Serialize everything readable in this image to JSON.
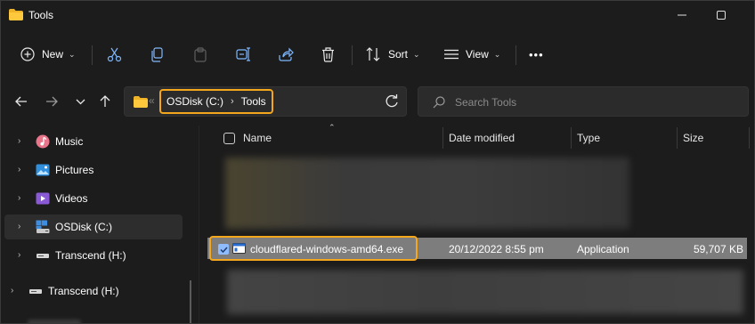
{
  "window": {
    "title": "Tools"
  },
  "toolbar": {
    "new_label": "New",
    "sort_label": "Sort",
    "view_label": "View",
    "more_label": "•••"
  },
  "address": {
    "overflow": "«",
    "crumbs": [
      "OSDisk (C:)",
      "Tools"
    ],
    "separator": "›"
  },
  "search": {
    "placeholder": "Search Tools"
  },
  "sidebar": {
    "items": [
      {
        "label": "Music",
        "icon": "music-icon"
      },
      {
        "label": "Pictures",
        "icon": "pictures-icon"
      },
      {
        "label": "Videos",
        "icon": "videos-icon"
      },
      {
        "label": "OSDisk (C:)",
        "icon": "drive-icon",
        "selected": true
      },
      {
        "label": "Transcend (H:)",
        "icon": "removable-drive-icon"
      },
      {
        "label": "Transcend (H:)",
        "icon": "removable-drive-icon"
      }
    ]
  },
  "columns": {
    "name": "Name",
    "date": "Date modified",
    "type": "Type",
    "size": "Size"
  },
  "files": [
    {
      "name": "cloudflared-windows-amd64.exe",
      "date": "20/12/2022 8:55 pm",
      "type": "Application",
      "size": "59,707 KB",
      "selected": true
    }
  ],
  "colors": {
    "background": "#1c1c1c",
    "highlight": "#f4a71c",
    "selected_row": "#7d7d7d",
    "checkbox_accent": "#8fbcff"
  }
}
